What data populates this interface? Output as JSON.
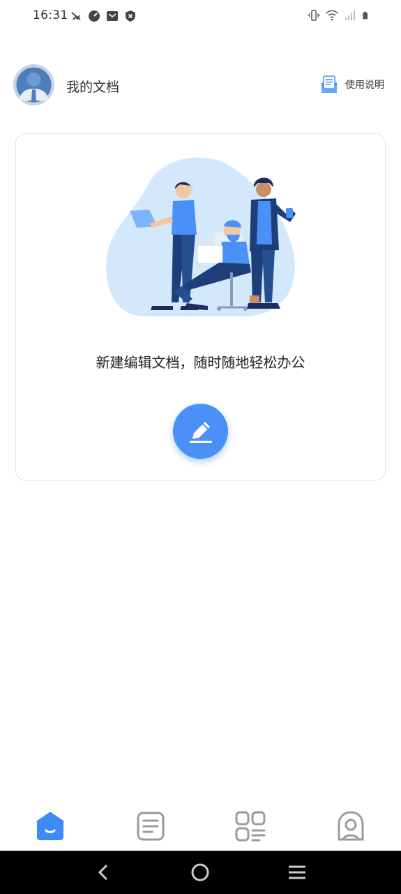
{
  "status_bar": {
    "time": "16:31",
    "left_icons": [
      "mute-icon",
      "speedometer-icon",
      "mail-icon",
      "shield-icon"
    ],
    "right_icons": [
      "vibrate-icon",
      "wifi-icon",
      "signal-icon",
      "battery-icon"
    ]
  },
  "header": {
    "title": "我的文档",
    "help_label": "使用说明"
  },
  "card": {
    "tagline": "新建编辑文档，随时随地轻松办公",
    "create_button_icon": "pencil-icon"
  },
  "tabbar": {
    "tabs": [
      {
        "icon": "home-icon",
        "active": true
      },
      {
        "icon": "document-icon",
        "active": false
      },
      {
        "icon": "apps-icon",
        "active": false
      },
      {
        "icon": "profile-icon",
        "active": false
      }
    ]
  },
  "colors": {
    "accent": "#4a90f6",
    "tab_active": "#3d8bf5",
    "tab_inactive": "#9a9a9a",
    "illustration_bg": "#d3e9fb",
    "navbar": "#000000"
  }
}
